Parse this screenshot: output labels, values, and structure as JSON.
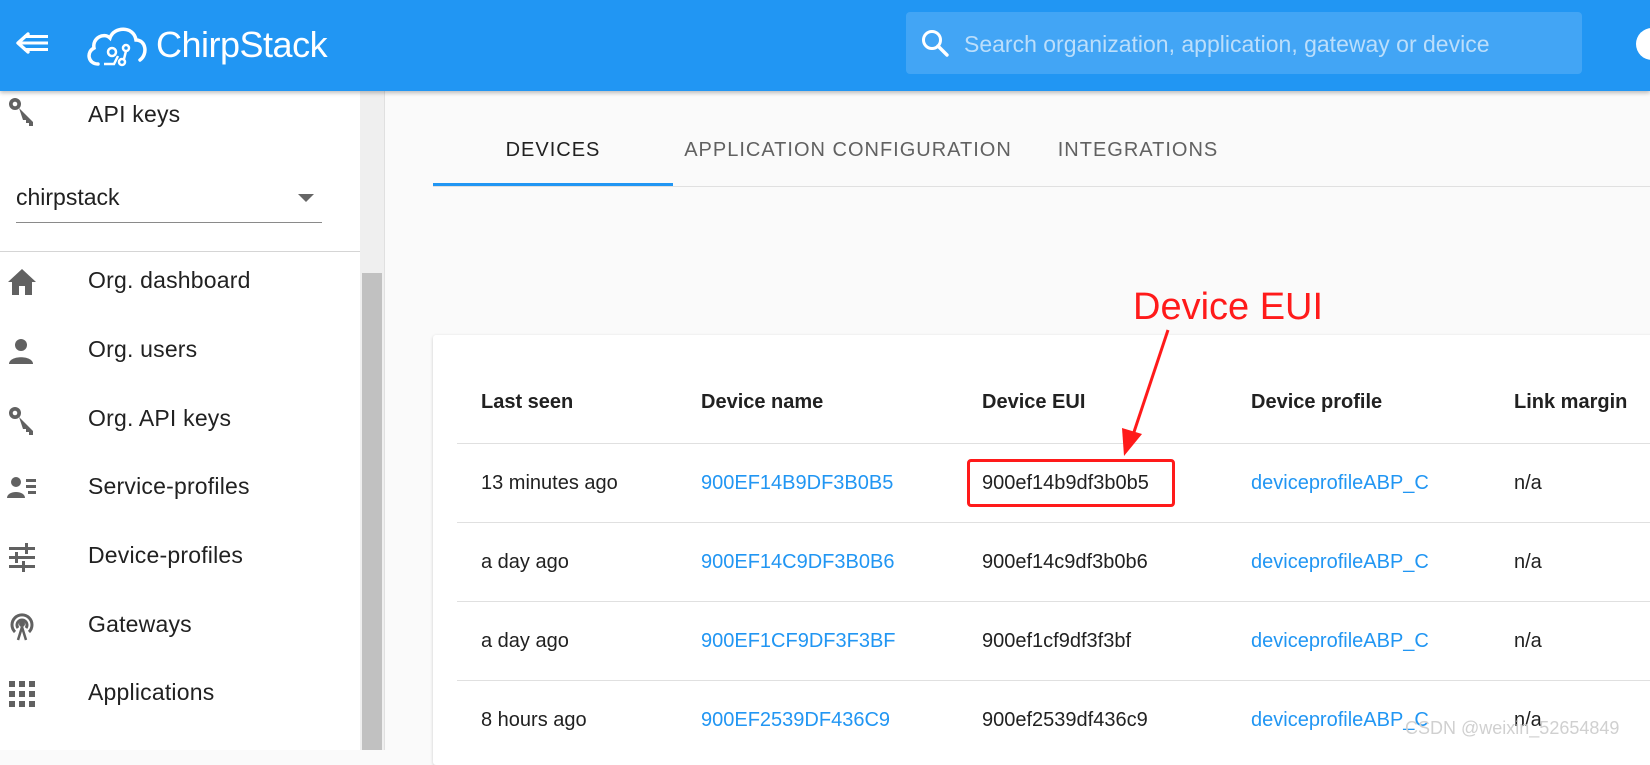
{
  "appbar": {
    "logo_text": "ChirpStack",
    "search_placeholder": "Search organization, application, gateway or device"
  },
  "sidebar": {
    "api_keys_label": "API keys",
    "org_select_value": "chirpstack",
    "items": [
      {
        "label": "Org. dashboard",
        "icon": "home-icon"
      },
      {
        "label": "Org. users",
        "icon": "person-icon"
      },
      {
        "label": "Org. API keys",
        "icon": "key-icon"
      },
      {
        "label": "Service-profiles",
        "icon": "account-details-icon"
      },
      {
        "label": "Device-profiles",
        "icon": "tune-icon"
      },
      {
        "label": "Gateways",
        "icon": "access-point-icon"
      },
      {
        "label": "Applications",
        "icon": "apps-icon"
      }
    ]
  },
  "tabs": [
    "DEVICES",
    "APPLICATION CONFIGURATION",
    "INTEGRATIONS"
  ],
  "table": {
    "headers": [
      "Last seen",
      "Device name",
      "Device EUI",
      "Device profile",
      "Link margin"
    ],
    "rows": [
      {
        "last_seen": "13 minutes ago",
        "name": "900EF14B9DF3B0B5",
        "eui": "900ef14b9df3b0b5",
        "profile": "deviceprofileABP_C",
        "link_margin": "n/a"
      },
      {
        "last_seen": "a day ago",
        "name": "900EF14C9DF3B0B6",
        "eui": "900ef14c9df3b0b6",
        "profile": "deviceprofileABP_C",
        "link_margin": "n/a"
      },
      {
        "last_seen": "a day ago",
        "name": "900EF1CF9DF3F3BF",
        "eui": "900ef1cf9df3f3bf",
        "profile": "deviceprofileABP_C",
        "link_margin": "n/a"
      },
      {
        "last_seen": "8 hours ago",
        "name": "900EF2539DF436C9",
        "eui": "900ef2539df436c9",
        "profile": "deviceprofileABP_C",
        "link_margin": "n/a"
      }
    ]
  },
  "annotation": {
    "label": "Device EUI",
    "color": "#ff1a1a"
  },
  "watermark": "CSDN @weixin_52654849",
  "colors": {
    "primary": "#2196f3",
    "link": "#2196f3"
  }
}
